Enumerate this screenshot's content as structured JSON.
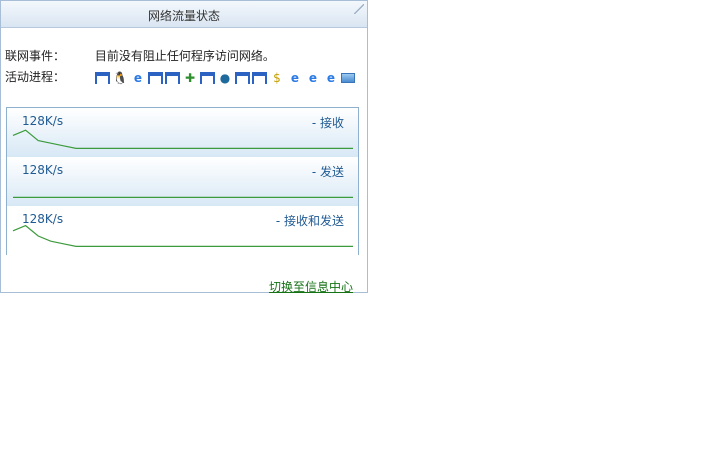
{
  "window": {
    "title": "网络流量状态"
  },
  "events": {
    "label": "联网事件：",
    "value": "目前没有阻止任何程序访问网络。"
  },
  "process": {
    "label": "活动进程：",
    "icons": [
      "window-icon",
      "qq-penguin-icon",
      "ie-icon",
      "window-icon",
      "window-icon",
      "shield-icon",
      "window-icon",
      "globe-icon",
      "window-icon",
      "window-icon",
      "money-icon",
      "ie-icon",
      "ie-icon",
      "ie-icon",
      "progress-bar-icon"
    ]
  },
  "graphs": [
    {
      "rate": "128K/s",
      "label": "- 接收",
      "series": [
        6,
        8,
        4,
        3,
        2,
        1,
        1,
        1,
        1,
        1,
        1,
        1,
        1,
        1,
        1,
        1,
        1,
        1,
        1,
        1,
        1,
        1,
        1,
        1,
        1,
        1,
        1,
        1
      ]
    },
    {
      "rate": "128K/s",
      "label": "- 发送",
      "series": [
        1,
        1,
        1,
        1,
        1,
        1,
        1,
        1,
        1,
        1,
        1,
        1,
        1,
        1,
        1,
        1,
        1,
        1,
        1,
        1,
        1,
        1,
        1,
        1,
        1,
        1,
        1,
        1
      ]
    },
    {
      "rate": "128K/s",
      "label": "- 接收和发送",
      "series": [
        7,
        9,
        5,
        3,
        2,
        1,
        1,
        1,
        1,
        1,
        1,
        1,
        1,
        1,
        1,
        1,
        1,
        1,
        1,
        1,
        1,
        1,
        1,
        1,
        1,
        1,
        1,
        1
      ]
    }
  ],
  "footer": {
    "link": "切换至信息中心"
  }
}
